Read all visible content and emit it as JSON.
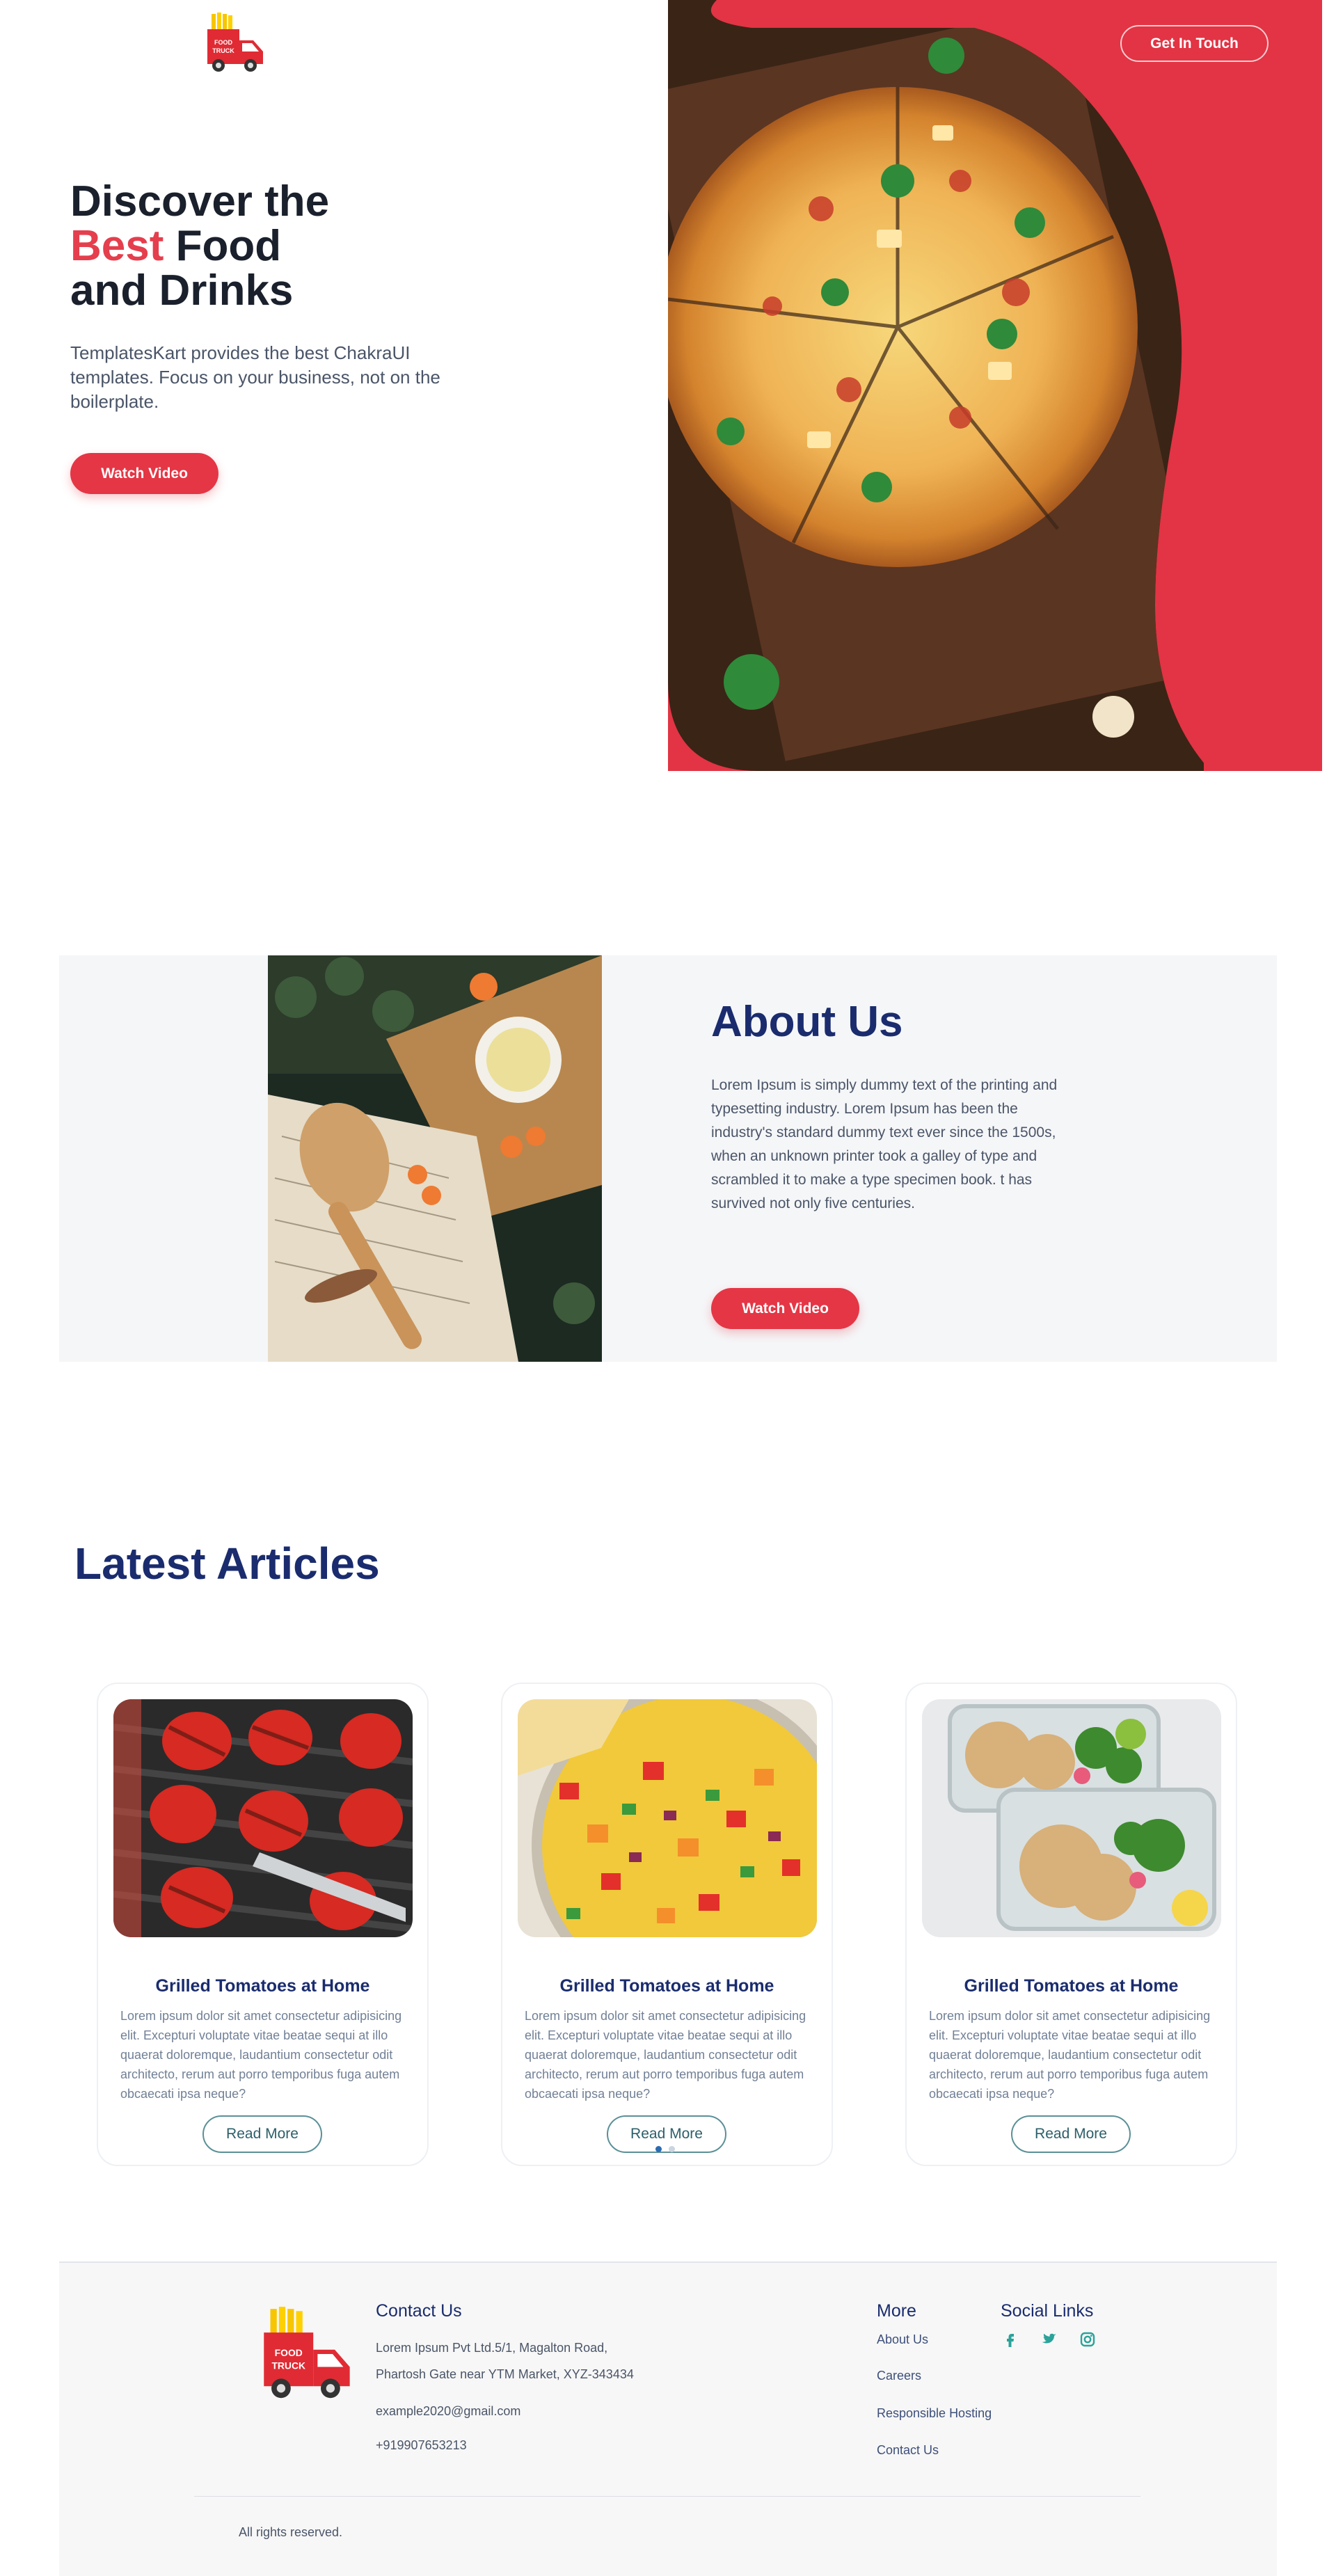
{
  "header": {
    "logo_text_top": "FOOD",
    "logo_text_bottom": "TRUCK",
    "cta_label": "Get In Touch"
  },
  "hero": {
    "title_line1": "Discover the",
    "title_accent": "Best",
    "title_line2_rest": "Food",
    "title_line3": "and Drinks",
    "description": "TemplatesKart provides the best ChakraUI templates. Focus on your business, not on the boilerplate.",
    "button_label": "Watch Video"
  },
  "about": {
    "title": "About Us",
    "text": "Lorem Ipsum is simply dummy text of the printing and typesetting industry. Lorem Ipsum has been the industry's standard dummy text ever since the 1500s, when an unknown printer took a galley of type and scrambled it to make a type specimen book. t has survived not only five centuries.",
    "button_label": "Watch Video"
  },
  "articles": {
    "title": "Latest Articles",
    "items": [
      {
        "title": "Grilled Tomatoes at Home",
        "text": "Lorem ipsum dolor sit amet consectetur adipisicing elit. Excepturi voluptate vitae beatae sequi at illo quaerat doloremque, laudantium consectetur odit architecto, rerum aut porro temporibus fuga autem obcaecati ipsa neque?",
        "button_label": "Read More"
      },
      {
        "title": "Grilled Tomatoes at Home",
        "text": "Lorem ipsum dolor sit amet consectetur adipisicing elit. Excepturi voluptate vitae beatae sequi at illo quaerat doloremque, laudantium consectetur odit architecto, rerum aut porro temporibus fuga autem obcaecati ipsa neque?",
        "button_label": "Read More"
      },
      {
        "title": "Grilled Tomatoes at Home",
        "text": "Lorem ipsum dolor sit amet consectetur adipisicing elit. Excepturi voluptate vitae beatae sequi at illo quaerat doloremque, laudantium consectetur odit architecto, rerum aut porro temporibus fuga autem obcaecati ipsa neque?",
        "button_label": "Read More"
      }
    ]
  },
  "footer": {
    "contact_heading": "Contact Us",
    "address_line1": "Lorem Ipsum Pvt Ltd.5/1, Magalton Road,",
    "address_line2": "Phartosh Gate near YTM Market, XYZ-343434",
    "email": "example2020@gmail.com",
    "phone": "+919907653213",
    "more_heading": "More",
    "more_links": [
      "About Us",
      "Careers",
      "Responsible Hosting",
      "Contact Us"
    ],
    "social_heading": "Social Links",
    "social_icons": [
      "facebook-icon",
      "twitter-icon",
      "instagram-icon"
    ],
    "rights": "All rights reserved."
  },
  "colors": {
    "brand_red": "#e53645",
    "heading_navy": "#1a2c6e",
    "social_teal": "#2aa39a"
  }
}
